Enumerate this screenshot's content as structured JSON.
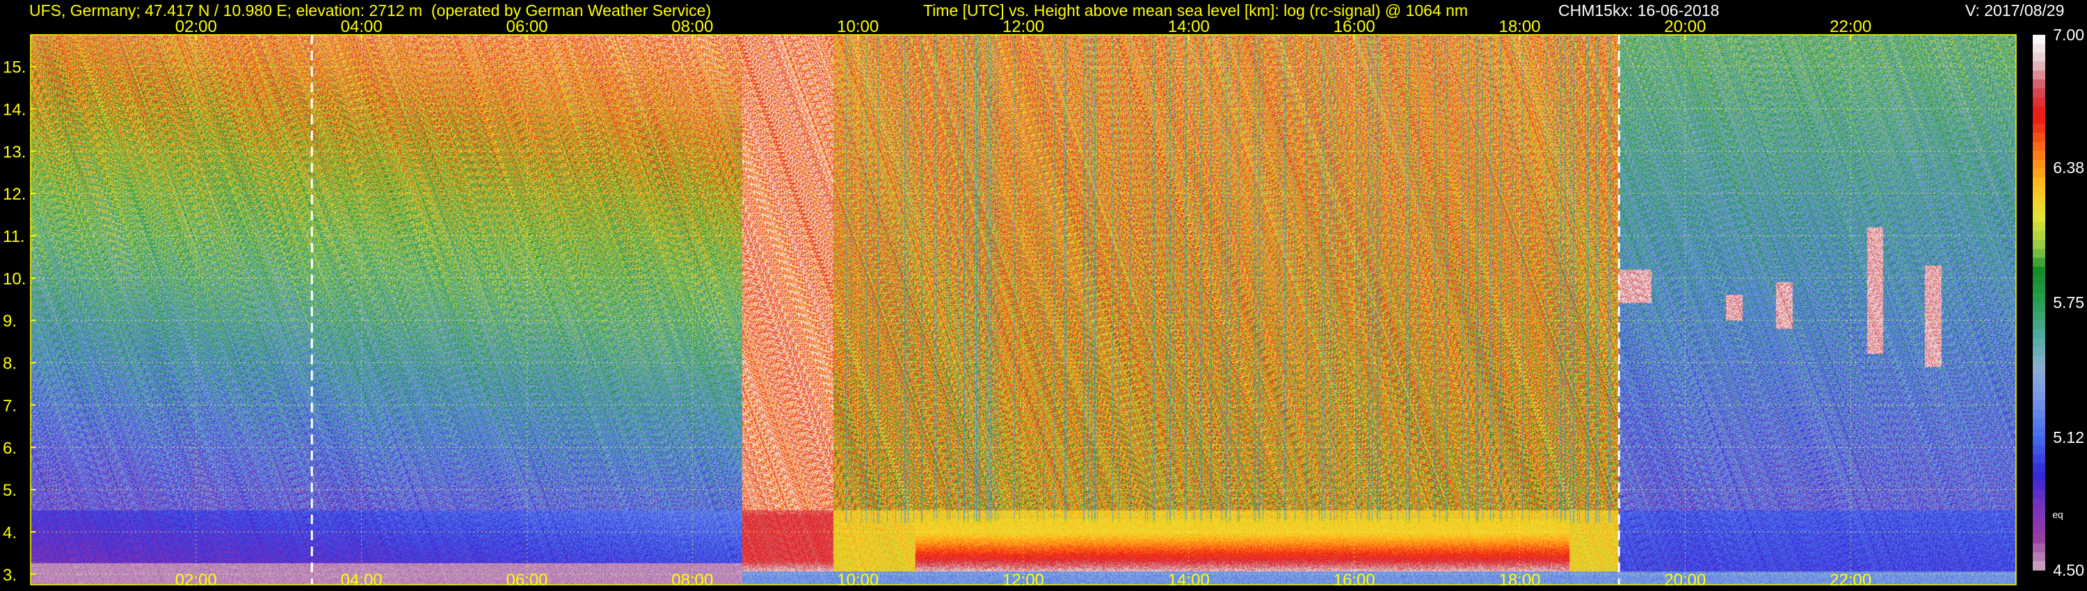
{
  "header": {
    "station": "UFS, Germany; 47.417 N / 10.980 E; elevation: 2712 m  (operated by German Weather Service)",
    "title": "Time [UTC] vs. Height above mean sea level [km]: log (rc-signal) @ 1064 nm",
    "device": "CHM15kx: 16-06-2018",
    "version": "V: 2017/08/29"
  },
  "colorbar": {
    "tick_labels": [
      "7.00",
      "6.38",
      "5.75",
      "5.12",
      "4.50"
    ],
    "tick_values": [
      7.0,
      6.38,
      5.75,
      5.12,
      4.5
    ],
    "range": [
      4.5,
      7.0
    ],
    "unit_label": "eq"
  },
  "chart_data": {
    "type": "heatmap",
    "title": "Time [UTC] vs. Height above mean sea level [km]: log (rc-signal) @ 1064 nm",
    "xlabel": "Time [UTC]",
    "ylabel": "Height above mean sea level [km]",
    "x_tick_labels": [
      "02:00",
      "04:00",
      "06:00",
      "08:00",
      "10:00",
      "12:00",
      "14:00",
      "16:00",
      "18:00",
      "20:00",
      "22:00"
    ],
    "x_ticks_hours": [
      2,
      4,
      6,
      8,
      10,
      12,
      14,
      16,
      18,
      20,
      22
    ],
    "xlim_hours": [
      0,
      24
    ],
    "y_tick_labels": [
      "3.",
      "4.",
      "5.",
      "6.",
      "7.",
      "8.",
      "9.",
      "10.",
      "11.",
      "12.",
      "13.",
      "14.",
      "15."
    ],
    "y_ticks_km": [
      3,
      4,
      5,
      6,
      7,
      8,
      9,
      10,
      11,
      12,
      13,
      14,
      15
    ],
    "ylim_km": [
      2.75,
      15.75
    ],
    "grid": true,
    "colorscale_range": [
      4.5,
      7.0
    ],
    "dashed_markers_hours": [
      3.4,
      19.2
    ],
    "features": [
      {
        "kind": "boundary layer",
        "x_start_hours": 8.6,
        "x_end_hours": 9.7,
        "y_bottom_km": 3.0,
        "y_top_km": 4.4
      },
      {
        "kind": "boundary layer",
        "x_start_hours": 10.7,
        "x_end_hours": 18.6,
        "y_bottom_km": 3.0,
        "y_top_km": 4.3
      },
      {
        "kind": "cirrus",
        "x_start_hours": 19.2,
        "x_end_hours": 19.6,
        "y_bottom_km": 9.4,
        "y_top_km": 10.2
      },
      {
        "kind": "cirrus",
        "x_start_hours": 20.5,
        "x_end_hours": 20.7,
        "y_bottom_km": 9.0,
        "y_top_km": 9.6
      },
      {
        "kind": "cirrus",
        "x_start_hours": 21.1,
        "x_end_hours": 21.3,
        "y_bottom_km": 8.8,
        "y_top_km": 9.9
      },
      {
        "kind": "cirrus",
        "x_start_hours": 22.2,
        "x_end_hours": 22.4,
        "y_bottom_km": 8.2,
        "y_top_km": 11.2
      },
      {
        "kind": "cirrus",
        "x_start_hours": 22.9,
        "x_end_hours": 23.1,
        "y_bottom_km": 7.9,
        "y_top_km": 10.3
      }
    ]
  }
}
